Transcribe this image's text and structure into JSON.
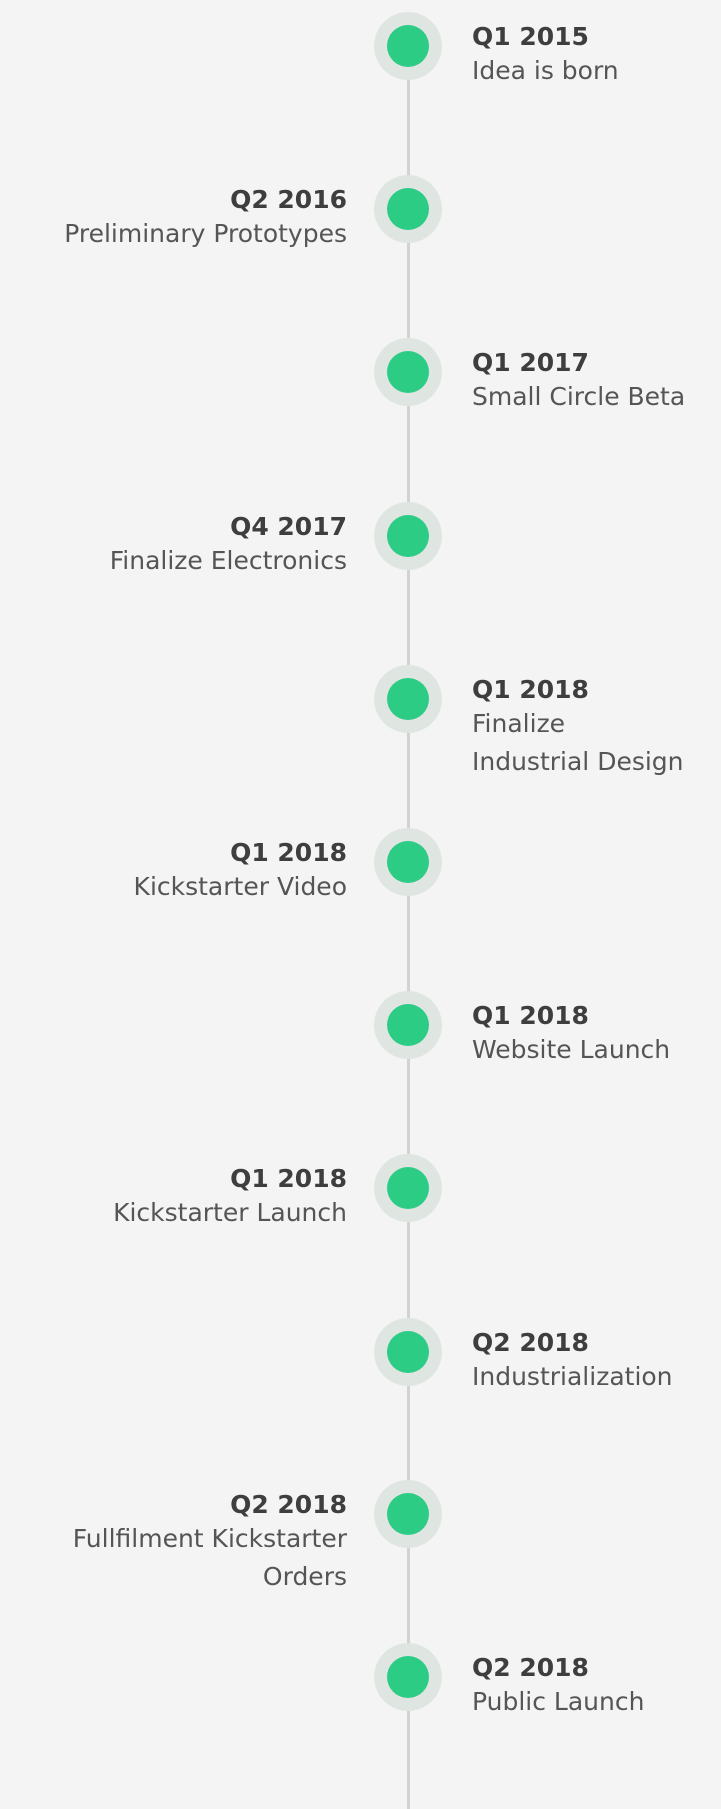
{
  "timeline": {
    "events": [
      {
        "date": "Q1 2015",
        "title_lines": [
          "Idea is born"
        ]
      },
      {
        "date": "Q2 2016",
        "title_lines": [
          "Preliminary Prototypes"
        ]
      },
      {
        "date": "Q1 2017",
        "title_lines": [
          "Small Circle Beta"
        ]
      },
      {
        "date": "Q4 2017",
        "title_lines": [
          "Finalize Electronics"
        ]
      },
      {
        "date": "Q1 2018",
        "title_lines": [
          "Finalize",
          "Industrial Design"
        ]
      },
      {
        "date": "Q1 2018",
        "title_lines": [
          "Kickstarter Video"
        ]
      },
      {
        "date": "Q1 2018",
        "title_lines": [
          "Website Launch"
        ]
      },
      {
        "date": "Q1 2018",
        "title_lines": [
          "Kickstarter Launch"
        ]
      },
      {
        "date": "Q2 2018",
        "title_lines": [
          "Industrialization"
        ]
      },
      {
        "date": "Q2 2018",
        "title_lines": [
          "Fullfilment Kickstarter",
          "Orders"
        ]
      },
      {
        "date": "Q2 2018",
        "title_lines": [
          "Public Launch"
        ]
      }
    ],
    "colors": {
      "dot": "#2dcc85",
      "halo": "#dfe6e2",
      "line": "#d2d2d2",
      "background": "#f4f4f4"
    }
  }
}
